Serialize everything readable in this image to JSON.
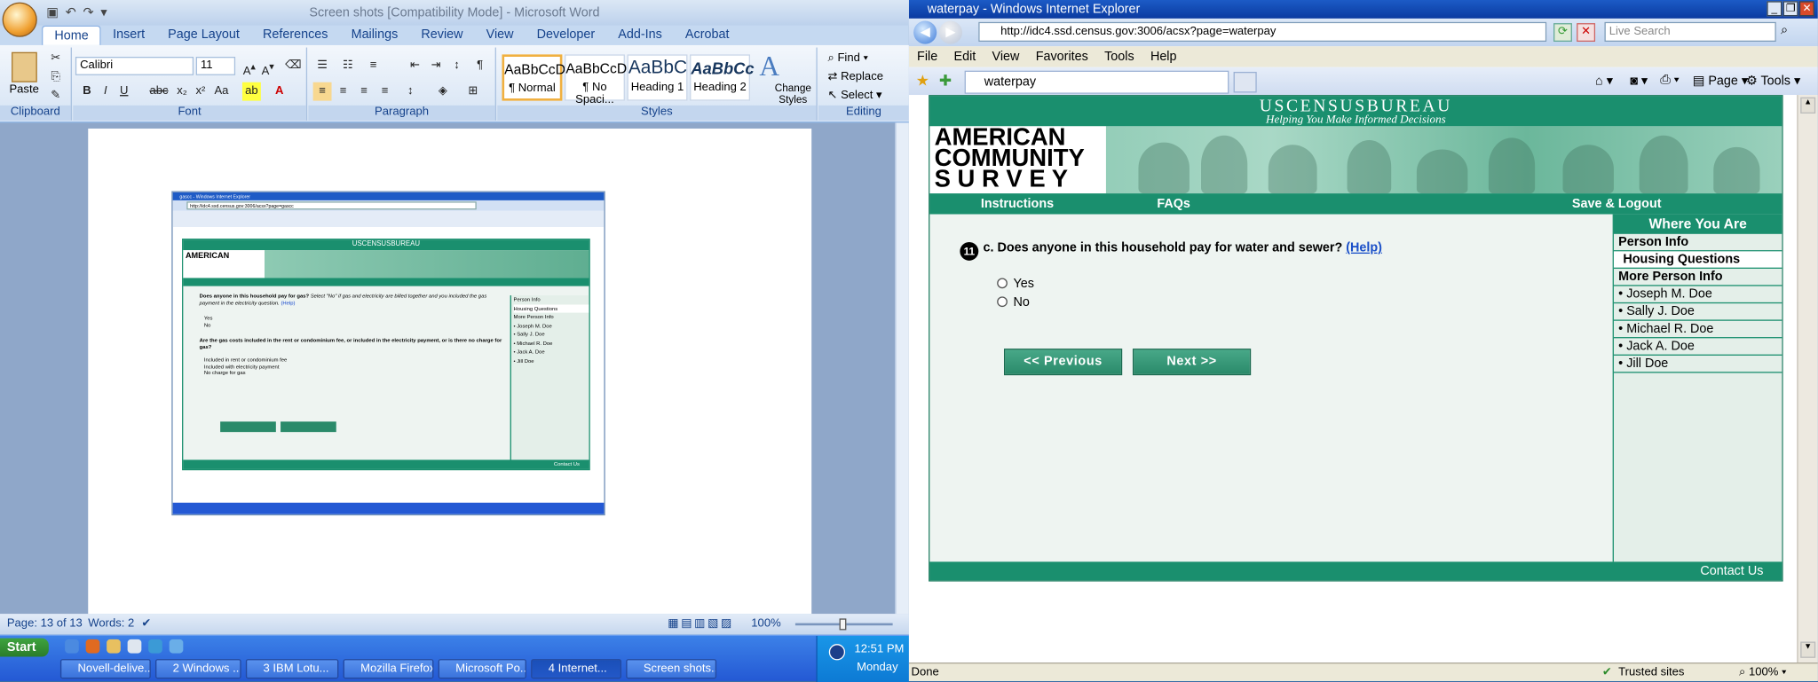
{
  "word": {
    "title": "Screen shots [Compatibility Mode] - Microsoft Word",
    "tabs": [
      "Home",
      "Insert",
      "Page Layout",
      "References",
      "Mailings",
      "Review",
      "View",
      "Developer",
      "Add-Ins",
      "Acrobat"
    ],
    "clipboard": {
      "paste": "Paste",
      "label": "Clipboard"
    },
    "font": {
      "family": "Calibri",
      "size": "11",
      "label": "Font"
    },
    "paragraph_label": "Paragraph",
    "styles": [
      {
        "preview": "AaBbCcDc",
        "name": "¶ Normal"
      },
      {
        "preview": "AaBbCcDc",
        "name": "¶ No Spaci..."
      },
      {
        "preview": "AaBbC",
        "name": "Heading 1"
      },
      {
        "preview": "AaBbCc",
        "name": "Heading 2"
      }
    ],
    "change_styles": "Change Styles",
    "styles_label": "Styles",
    "editing": {
      "find": "Find",
      "replace": "Replace",
      "select": "Select",
      "label": "Editing"
    },
    "status": {
      "page": "Page: 13 of 13",
      "words": "Words: 2",
      "zoom": "100%"
    },
    "embedded": {
      "title": "gascc - Windows Internet Explorer",
      "address": "http://idc4.ssd.census.gov:3006/acsx?page=gascc",
      "question": "Does anyone in this household pay for gas?",
      "question_note": "Select \"No\" if gas and electricity are billed together and you included the gas payment in the electricity question.",
      "help": "(Help)",
      "options1": [
        "Yes",
        "No"
      ],
      "question2": "Are the gas costs included in the rent or condominium fee, or included in the electricity payment, or is there no charge for gas?",
      "options2": [
        "Included in rent or condominium fee",
        "Included with electricity payment",
        "No charge for gas"
      ],
      "sidebar": [
        "Person Info",
        "Housing Questions",
        "More Person Info",
        "• Joseph M. Doe",
        "• Sally J. Doe",
        "• Michael R. Doe",
        "• Jack A. Doe",
        "• Jill Doe"
      ],
      "footer": "Contact Us"
    }
  },
  "ie": {
    "title": "waterpay - Windows Internet Explorer",
    "address": "http://idc4.ssd.census.gov:3006/acsx?page=waterpay",
    "search_placeholder": "Live Search",
    "menu": [
      "File",
      "Edit",
      "View",
      "Favorites",
      "Tools",
      "Help"
    ],
    "tab": "waterpay",
    "cmd": {
      "page": "Page",
      "tools": "Tools"
    },
    "status_left": "Done",
    "status_zone": "Trusted sites",
    "zoom": "100%"
  },
  "census": {
    "agency": "USCENSUSBUREAU",
    "tagline": "Helping You Make Informed Decisions",
    "logo": [
      "AMERICAN",
      "COMMUNITY",
      "S U R V E Y"
    ],
    "nav": {
      "instructions": "Instructions",
      "faqs": "FAQs",
      "save": "Save & Logout"
    },
    "question_number": "11",
    "question": "c. Does anyone in this household pay for water and sewer?",
    "help": "(Help)",
    "options": [
      "Yes",
      "No"
    ],
    "prev": "<<   Previous",
    "next": "Next   >>",
    "sidebar_title": "Where You Are",
    "sidebar": [
      "Person Info",
      "Housing Questions",
      "More Person Info",
      "• Joseph M. Doe",
      "• Sally J. Doe",
      "• Michael R. Doe",
      "• Jack A. Doe",
      "• Jill Doe"
    ],
    "footer": "Contact Us"
  },
  "taskbar": {
    "start": "Start",
    "buttons": [
      "Novell-delive...",
      "2 Windows ...",
      "3 IBM Lotu...",
      "Mozilla Firefox",
      "Microsoft Po...",
      "4 Internet...",
      "Screen shots..."
    ],
    "clock": "12:51 PM",
    "day": "Monday"
  }
}
